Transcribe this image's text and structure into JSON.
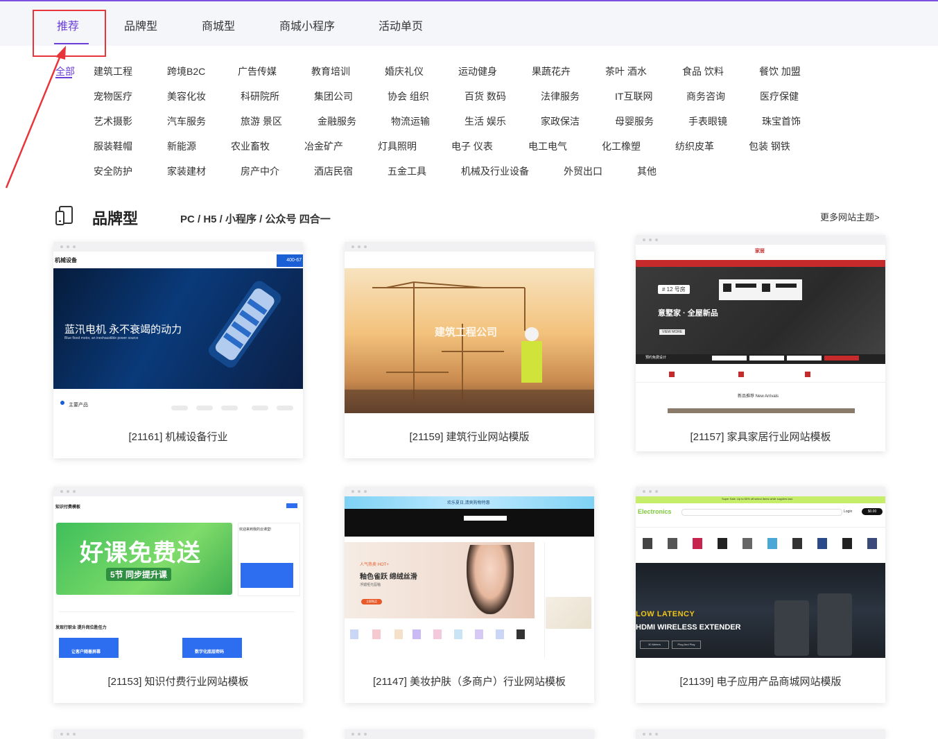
{
  "tabs": [
    "推荐",
    "品牌型",
    "商城型",
    "商城小程序",
    "活动单页"
  ],
  "active_tab": "推荐",
  "categories": {
    "all": "全部",
    "rows": [
      [
        "建筑工程",
        "跨境B2C",
        "广告传媒",
        "教育培训",
        "婚庆礼仪",
        "运动健身",
        "果蔬花卉",
        "茶叶 酒水",
        "食品 饮料",
        "餐饮 加盟"
      ],
      [
        "宠物医疗",
        "美容化妆",
        "科研院所",
        "集团公司",
        "协会 组织",
        "百货 数码",
        "法律服务",
        "IT互联网",
        "商务咨询",
        "医疗保健"
      ],
      [
        "艺术摄影",
        "汽车服务",
        "旅游 景区",
        "金融服务",
        "物流运输",
        "生活 娱乐",
        "家政保洁",
        "母婴服务",
        "手表眼镜",
        "珠宝首饰"
      ],
      [
        "服装鞋帽",
        "新能源",
        "农业畜牧",
        "冶金矿产",
        "灯具照明",
        "电子 仪表",
        "电工电气",
        "化工橡塑",
        "纺织皮革",
        "包装 钢铁"
      ],
      [
        "安全防护",
        "家装建材",
        "房产中介",
        "酒店民宿",
        "五金工具",
        "机械及行业设备",
        "外贸出口",
        "其他"
      ]
    ]
  },
  "section": {
    "title": "品牌型",
    "subtitle": "PC / H5 / 小程序 / 公众号 四合一",
    "more": "更多网站主题>"
  },
  "cards": [
    {
      "name": "[21161] 机械设备行业",
      "banner": "蓝汛电机 永不衰竭的动力",
      "banner_sub": "Blue flood motor, an inexhaustible power source",
      "logo": "机械设备",
      "phone": "400-67",
      "footer": "主要产品"
    },
    {
      "name": "[21159] 建筑行业网站模版",
      "banner": "建筑工程公司"
    },
    {
      "name": "[21157] 家具家居行业网站模板",
      "logo": "家居",
      "room": "# 12 号房",
      "banner": "意墅家 · 全屋新品",
      "btn": "VIEW MORE",
      "form": "预约免费设计",
      "new": "新品推荐 New Arrivals"
    },
    {
      "name": "[21153] 知识付费行业网站模板",
      "logo": "知识付费模板",
      "banner": "好课免费送",
      "banner_sub": "5节 同步提升课",
      "side": "欢迎来到我的云课堂!",
      "bottom": "发现行职业 提升岗位胜任力",
      "promo1": "让客户随着屏幕",
      "promo2": "数字化底层密码"
    },
    {
      "name": "[21147] 美妆护肤（多商户）行业网站模板",
      "top": "欢乐夏日,清爽购物特惠",
      "tag": "人气热卖 HOT+",
      "banner": "釉色雀跃 绵绒丝滑",
      "banner_sub": "浮媚哑光唇釉",
      "btn": "立即购买"
    },
    {
      "name": "[21139] 电子应用产品商城网站模版",
      "top": "Super Sale. Up to 50% off select items while supplies last.",
      "logo": "Electronics",
      "login": "Login",
      "cart": "$0.00",
      "banner1": "LOW LATENCY",
      "banner2": "HDMI WIRELESS EXTENDER",
      "pill1": "30 Meters",
      "pill2": "Plug And Play"
    }
  ],
  "colors": {
    "accent": "#6a3fd8",
    "highlight": "#e8353a"
  }
}
